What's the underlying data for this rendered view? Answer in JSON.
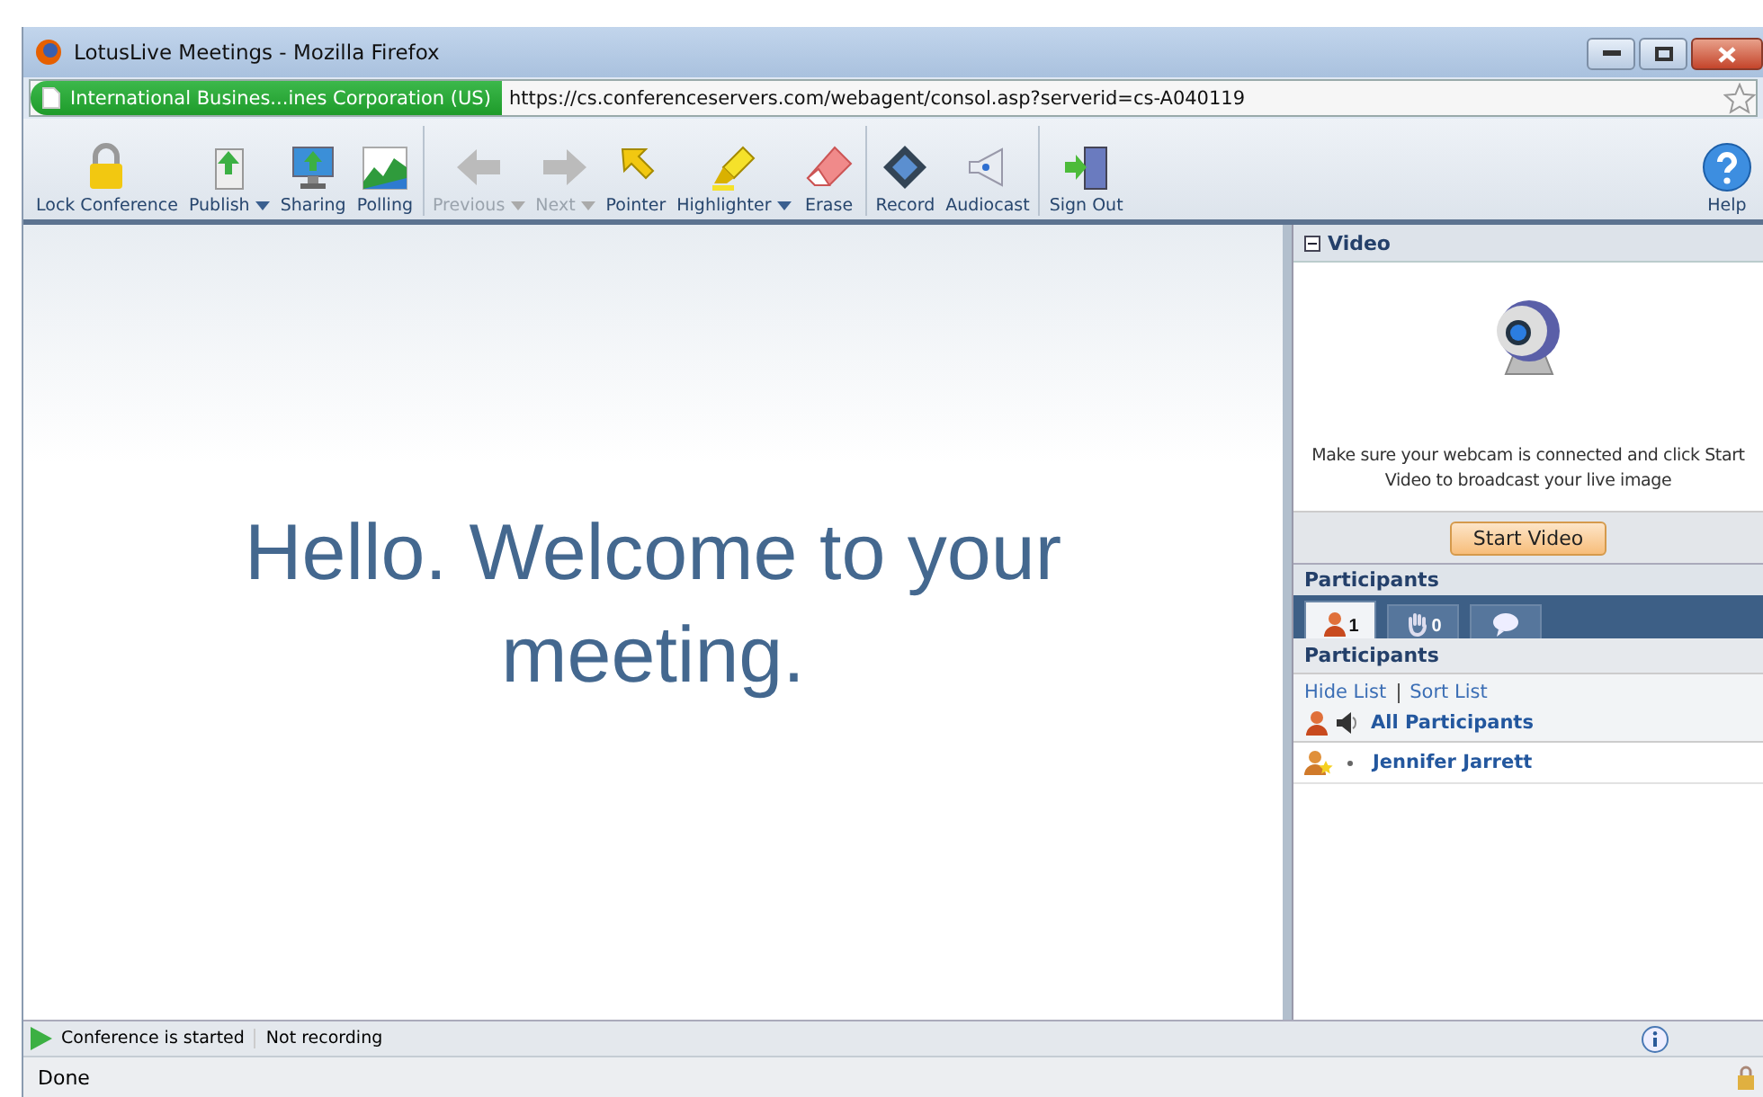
{
  "window": {
    "title": "LotusLive Meetings - Mozilla Firefox"
  },
  "address_bar": {
    "identity": "International Busines...ines Corporation (US)",
    "url": "https://cs.conferenceservers.com/webagent/consol.asp?serverid=cs-A040119"
  },
  "toolbar": [
    {
      "label": "Lock Conference",
      "disabled": false,
      "dropdown": false
    },
    {
      "label": "Publish",
      "disabled": false,
      "dropdown": true
    },
    {
      "label": "Sharing",
      "disabled": false,
      "dropdown": false
    },
    {
      "label": "Polling",
      "disabled": false,
      "dropdown": false
    },
    {
      "label": "Previous",
      "disabled": true,
      "dropdown": true
    },
    {
      "label": "Next",
      "disabled": true,
      "dropdown": true
    },
    {
      "label": "Pointer",
      "disabled": false,
      "dropdown": false
    },
    {
      "label": "Highlighter",
      "disabled": false,
      "dropdown": true
    },
    {
      "label": "Erase",
      "disabled": false,
      "dropdown": false
    },
    {
      "label": "Record",
      "disabled": false,
      "dropdown": false
    },
    {
      "label": "Audiocast",
      "disabled": false,
      "dropdown": false
    },
    {
      "label": "Sign Out",
      "disabled": false,
      "dropdown": false
    }
  ],
  "help": {
    "label": "Help"
  },
  "slide": {
    "text": "Hello. Welcome to your meeting."
  },
  "video_panel": {
    "title": "Video",
    "expanded": true,
    "message": "Make sure your webcam is connected and click Start Video to broadcast your live image",
    "button": "Start Video"
  },
  "participants_panel": {
    "title": "Participants",
    "tabs": [
      {
        "count": "1",
        "selected": true
      },
      {
        "count": "0",
        "selected": false
      },
      {
        "selected": false
      }
    ],
    "subtitle": "Participants",
    "links": [
      "Hide List",
      "Sort List"
    ],
    "all_label": "All Participants",
    "people": [
      {
        "name": "Jennifer Jarrett"
      }
    ]
  },
  "status_bar": {
    "conference": "Conference is started",
    "recording": "Not recording"
  },
  "browser_status": {
    "text": "Done"
  }
}
